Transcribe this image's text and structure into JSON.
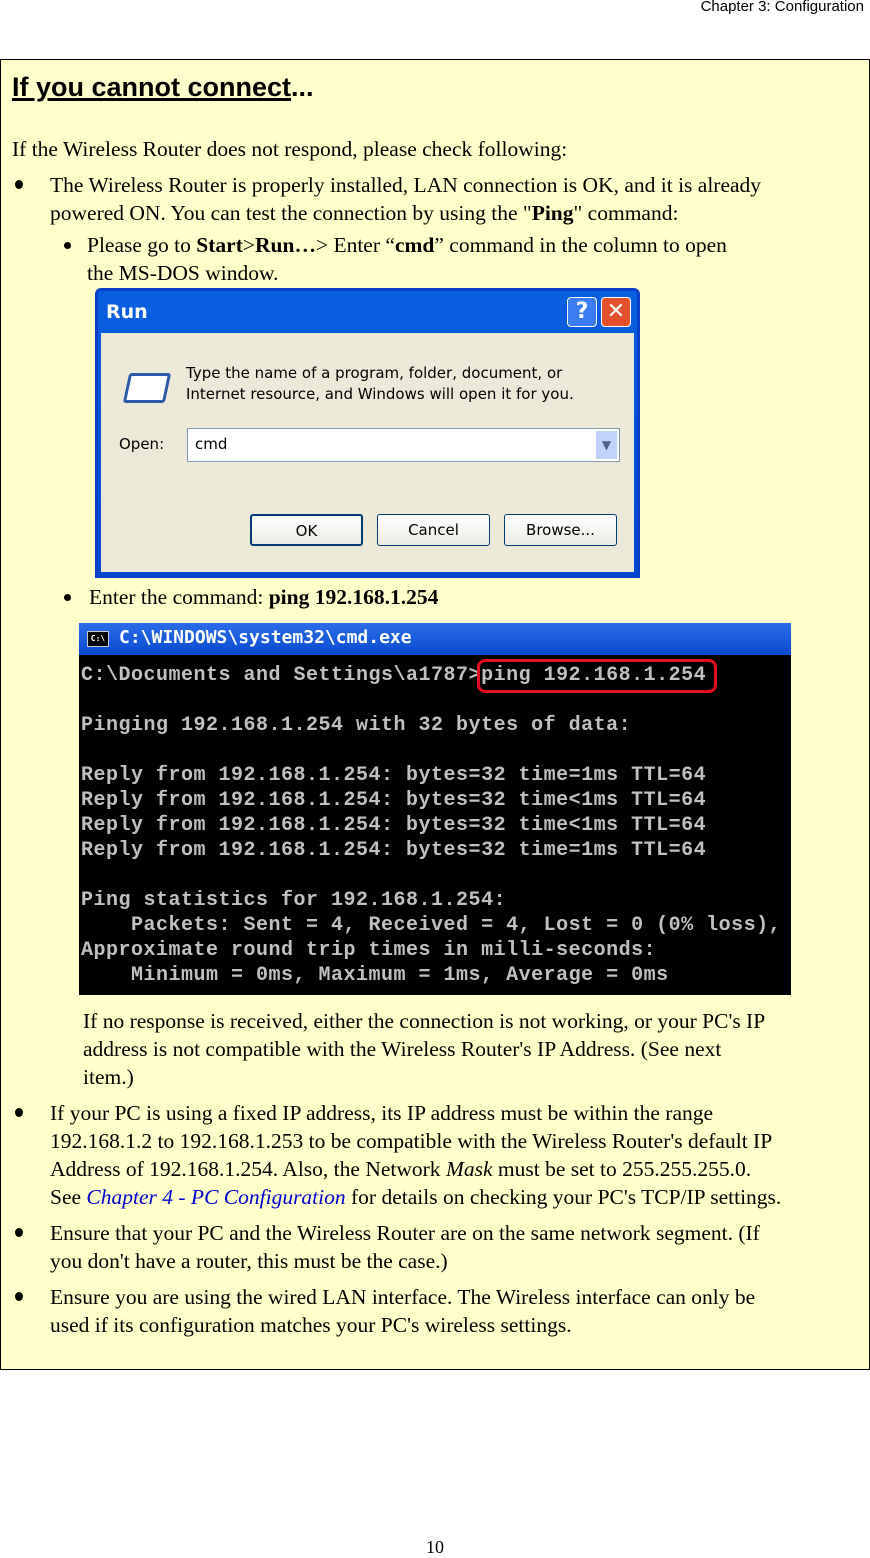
{
  "header": "Chapter 3: Configuration",
  "heading_main": "If you cannot connect",
  "heading_tail": "...",
  "intro": "If the Wireless Router does not respond, please check following:",
  "b1": {
    "l1": "The Wireless Router is properly installed, LAN connection is OK, and it is already",
    "l2a": "powered ON. You can test the connection by using the \"",
    "l2b": "Ping",
    "l2c": "\" command:"
  },
  "s1": {
    "a": "Please go to ",
    "b": "Start",
    ">": ">",
    "c": "Run…",
    "d": "> Enter “",
    "e": "cmd",
    "f": "” command in the column to open",
    "l2": "the MS-DOS window."
  },
  "run": {
    "title": "Run",
    "help": "?",
    "close": "✕",
    "desc1": "Type the name of a program, folder, document, or",
    "desc2": "Internet resource, and Windows will open it for you.",
    "open_label": "Open:",
    "open_value": "cmd",
    "ok": "OK",
    "cancel": "Cancel",
    "browse": "Browse..."
  },
  "s2": {
    "a": "Enter the command:  ",
    "b": "ping 192.168.1.254"
  },
  "cmd": {
    "title": "C:\\WINDOWS\\system32\\cmd.exe",
    "icon": "C:\\",
    "lines": [
      "C:\\Documents and Settings\\a1787>ping 192.168.1.254",
      "",
      "Pinging 192.168.1.254 with 32 bytes of data:",
      "",
      "Reply from 192.168.1.254: bytes=32 time=1ms TTL=64",
      "Reply from 192.168.1.254: bytes=32 time<1ms TTL=64",
      "Reply from 192.168.1.254: bytes=32 time<1ms TTL=64",
      "Reply from 192.168.1.254: bytes=32 time=1ms TTL=64",
      "",
      "Ping statistics for 192.168.1.254:",
      "    Packets: Sent = 4, Received = 4, Lost = 0 (0% loss),",
      "Approximate round trip times in milli-seconds:",
      "    Minimum = 0ms, Maximum = 1ms, Average = 0ms"
    ]
  },
  "noresp": [
    "If no response is received, either the connection is not working, or your PC's IP",
    "address is not compatible with the Wireless Router's IP Address. (See next",
    "item.)"
  ],
  "b2": {
    "l1": "If your PC is using a fixed IP address, its IP address must be within the range",
    "l2": "192.168.1.2 to 192.168.1.253 to be compatible with the Wireless Router's default IP",
    "l3a": "Address of 192.168.1.254. Also, the Network ",
    "l3b": "Mask",
    "l3c": " must be set to 255.255.255.0.",
    "l4a": "See ",
    "link": "Chapter 4 - PC Configuration",
    "l4b": " for details on checking your PC's TCP/IP settings."
  },
  "b3": [
    "Ensure that your PC and the Wireless Router are on the same network segment. (If",
    "you don't have a router, this must be the case.)"
  ],
  "b4": [
    "Ensure you are using the wired LAN interface. The Wireless interface can only be",
    "used if its configuration matches your PC's wireless settings."
  ],
  "page_number": "10"
}
